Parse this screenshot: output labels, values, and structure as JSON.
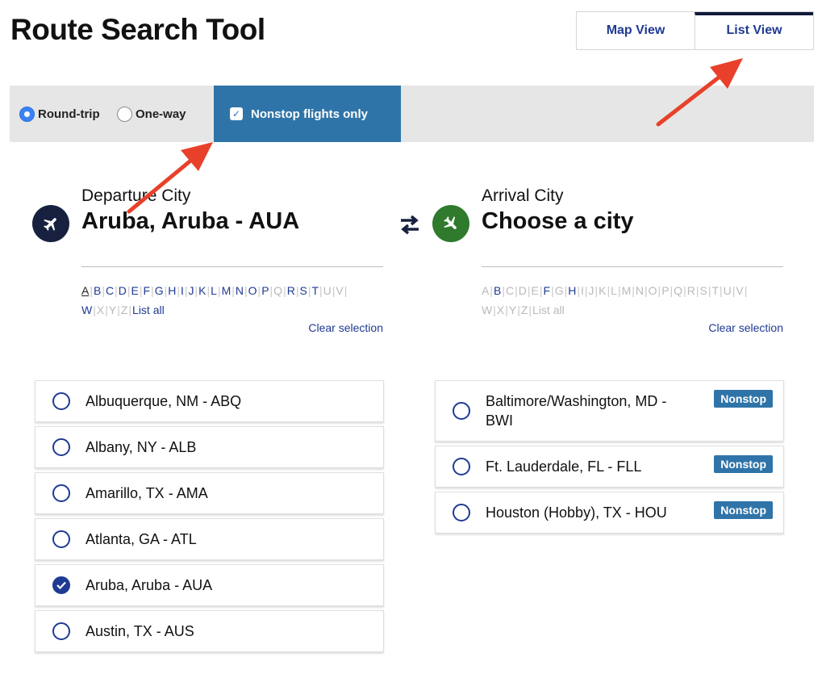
{
  "header": {
    "title": "Route Search Tool"
  },
  "view_tabs": [
    {
      "label": "Map View",
      "active": false
    },
    {
      "label": "List View",
      "active": true
    }
  ],
  "filters": {
    "trip_types": [
      {
        "label": "Round-trip",
        "checked": true
      },
      {
        "label": "One-way",
        "checked": false
      }
    ],
    "nonstop": {
      "label": "Nonstop flights only",
      "checked": true
    }
  },
  "departure": {
    "heading": "Departure City",
    "value": "Aruba, Aruba - AUA",
    "icon": "airplane-departure-icon",
    "clear_label": "Clear selection",
    "letters": [
      {
        "t": "A",
        "s": "sel"
      },
      {
        "t": "B",
        "s": ""
      },
      {
        "t": "C",
        "s": ""
      },
      {
        "t": "D",
        "s": ""
      },
      {
        "t": "E",
        "s": ""
      },
      {
        "t": "F",
        "s": ""
      },
      {
        "t": "G",
        "s": ""
      },
      {
        "t": "H",
        "s": ""
      },
      {
        "t": "I",
        "s": ""
      },
      {
        "t": "J",
        "s": ""
      },
      {
        "t": "K",
        "s": ""
      },
      {
        "t": "L",
        "s": ""
      },
      {
        "t": "M",
        "s": ""
      },
      {
        "t": "N",
        "s": ""
      },
      {
        "t": "O",
        "s": ""
      },
      {
        "t": "P",
        "s": ""
      },
      {
        "t": "Q",
        "s": "dis"
      },
      {
        "t": "R",
        "s": ""
      },
      {
        "t": "S",
        "s": ""
      },
      {
        "t": "T",
        "s": ""
      },
      {
        "t": "U",
        "s": "dis"
      },
      {
        "t": "V",
        "s": "dis"
      },
      {
        "t": "W",
        "s": ""
      },
      {
        "t": "X",
        "s": "dis"
      },
      {
        "t": "Y",
        "s": "dis"
      },
      {
        "t": "Z",
        "s": "dis"
      },
      {
        "t": "List all",
        "s": ""
      }
    ],
    "cities": [
      {
        "name": "Albuquerque, NM - ABQ",
        "checked": false
      },
      {
        "name": "Albany, NY - ALB",
        "checked": false
      },
      {
        "name": "Amarillo, TX - AMA",
        "checked": false
      },
      {
        "name": "Atlanta, GA - ATL",
        "checked": false
      },
      {
        "name": "Aruba, Aruba - AUA",
        "checked": true
      },
      {
        "name": "Austin, TX - AUS",
        "checked": false
      }
    ]
  },
  "arrival": {
    "heading": "Arrival City",
    "value": "Choose a city",
    "icon": "airplane-arrival-icon",
    "clear_label": "Clear selection",
    "letters": [
      {
        "t": "A",
        "s": "dis"
      },
      {
        "t": "B",
        "s": ""
      },
      {
        "t": "C",
        "s": "dis"
      },
      {
        "t": "D",
        "s": "dis"
      },
      {
        "t": "E",
        "s": "dis"
      },
      {
        "t": "F",
        "s": ""
      },
      {
        "t": "G",
        "s": "dis"
      },
      {
        "t": "H",
        "s": ""
      },
      {
        "t": "I",
        "s": "dis"
      },
      {
        "t": "J",
        "s": "dis"
      },
      {
        "t": "K",
        "s": "dis"
      },
      {
        "t": "L",
        "s": "dis"
      },
      {
        "t": "M",
        "s": "dis"
      },
      {
        "t": "N",
        "s": "dis"
      },
      {
        "t": "O",
        "s": "dis"
      },
      {
        "t": "P",
        "s": "dis"
      },
      {
        "t": "Q",
        "s": "dis"
      },
      {
        "t": "R",
        "s": "dis"
      },
      {
        "t": "S",
        "s": "dis"
      },
      {
        "t": "T",
        "s": "dis"
      },
      {
        "t": "U",
        "s": "dis"
      },
      {
        "t": "V",
        "s": "dis"
      },
      {
        "t": "W",
        "s": "dis"
      },
      {
        "t": "X",
        "s": "dis"
      },
      {
        "t": "Y",
        "s": "dis"
      },
      {
        "t": "Z",
        "s": "dis"
      },
      {
        "t": "List all",
        "s": "dis"
      }
    ],
    "cities": [
      {
        "name": "Baltimore/Washington, MD - BWI",
        "badge": "Nonstop"
      },
      {
        "name": "Ft. Lauderdale, FL - FLL",
        "badge": "Nonstop"
      },
      {
        "name": "Houston (Hobby), TX - HOU",
        "badge": "Nonstop"
      }
    ]
  },
  "colors": {
    "brand_navy": "#1f3a93",
    "toggle_blue": "#2f74a8",
    "annotation_arrow": "#e8402a"
  }
}
